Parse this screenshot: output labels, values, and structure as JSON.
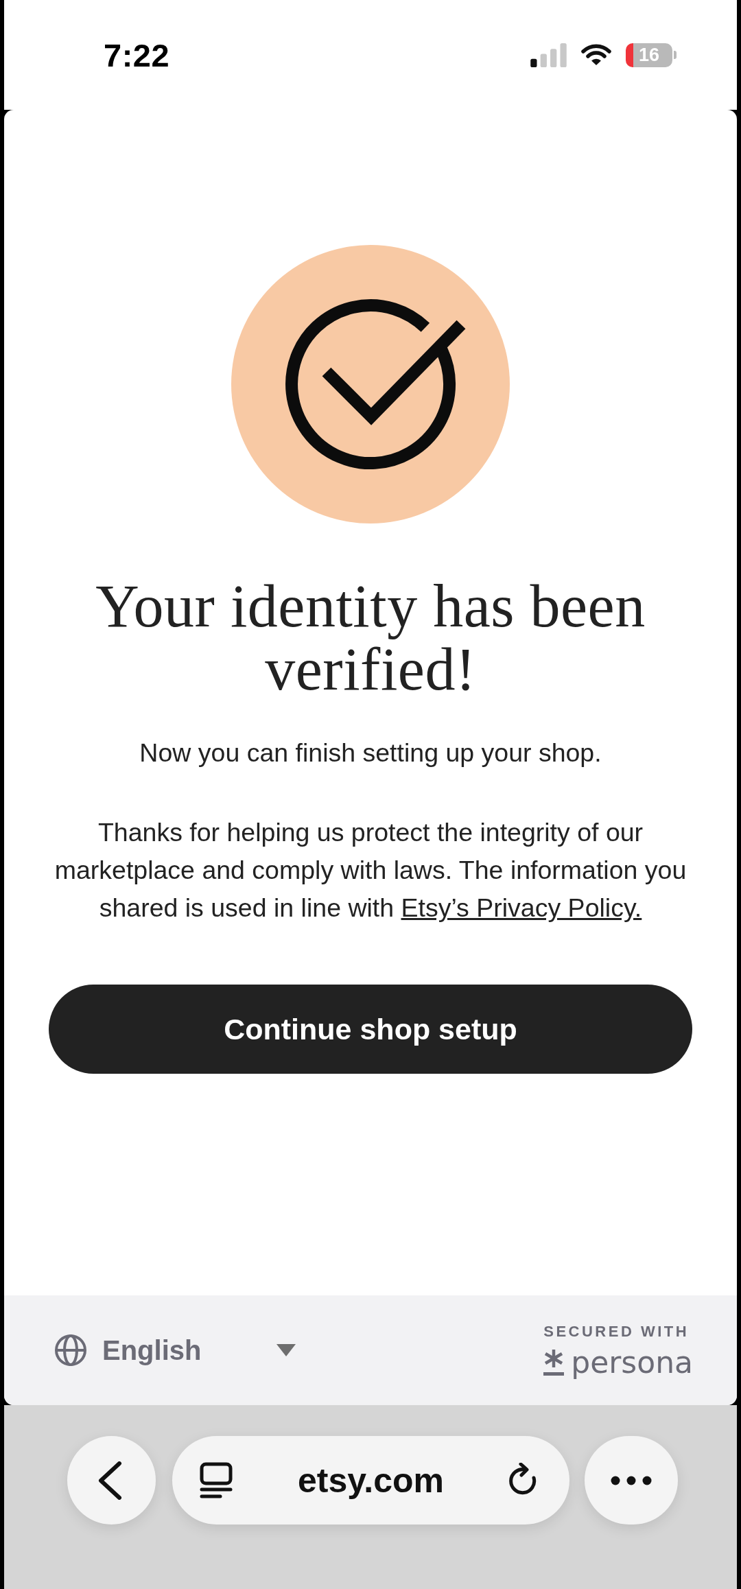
{
  "status_bar": {
    "time": "7:22",
    "battery": "16"
  },
  "heading": "Your identity has been verified!",
  "subtitle": "Now you can finish setting up your shop.",
  "body": {
    "text": "Thanks for helping us protect the integrity of our marketplace and comply with laws. The information you shared is used in line with",
    "link": "Etsy’s Privacy Policy."
  },
  "primary_button": "Continue shop setup",
  "footer": {
    "language": "English",
    "secured_label": "SECURED WITH",
    "brand": "persona"
  },
  "browser_bar": {
    "url": "etsy.com"
  }
}
